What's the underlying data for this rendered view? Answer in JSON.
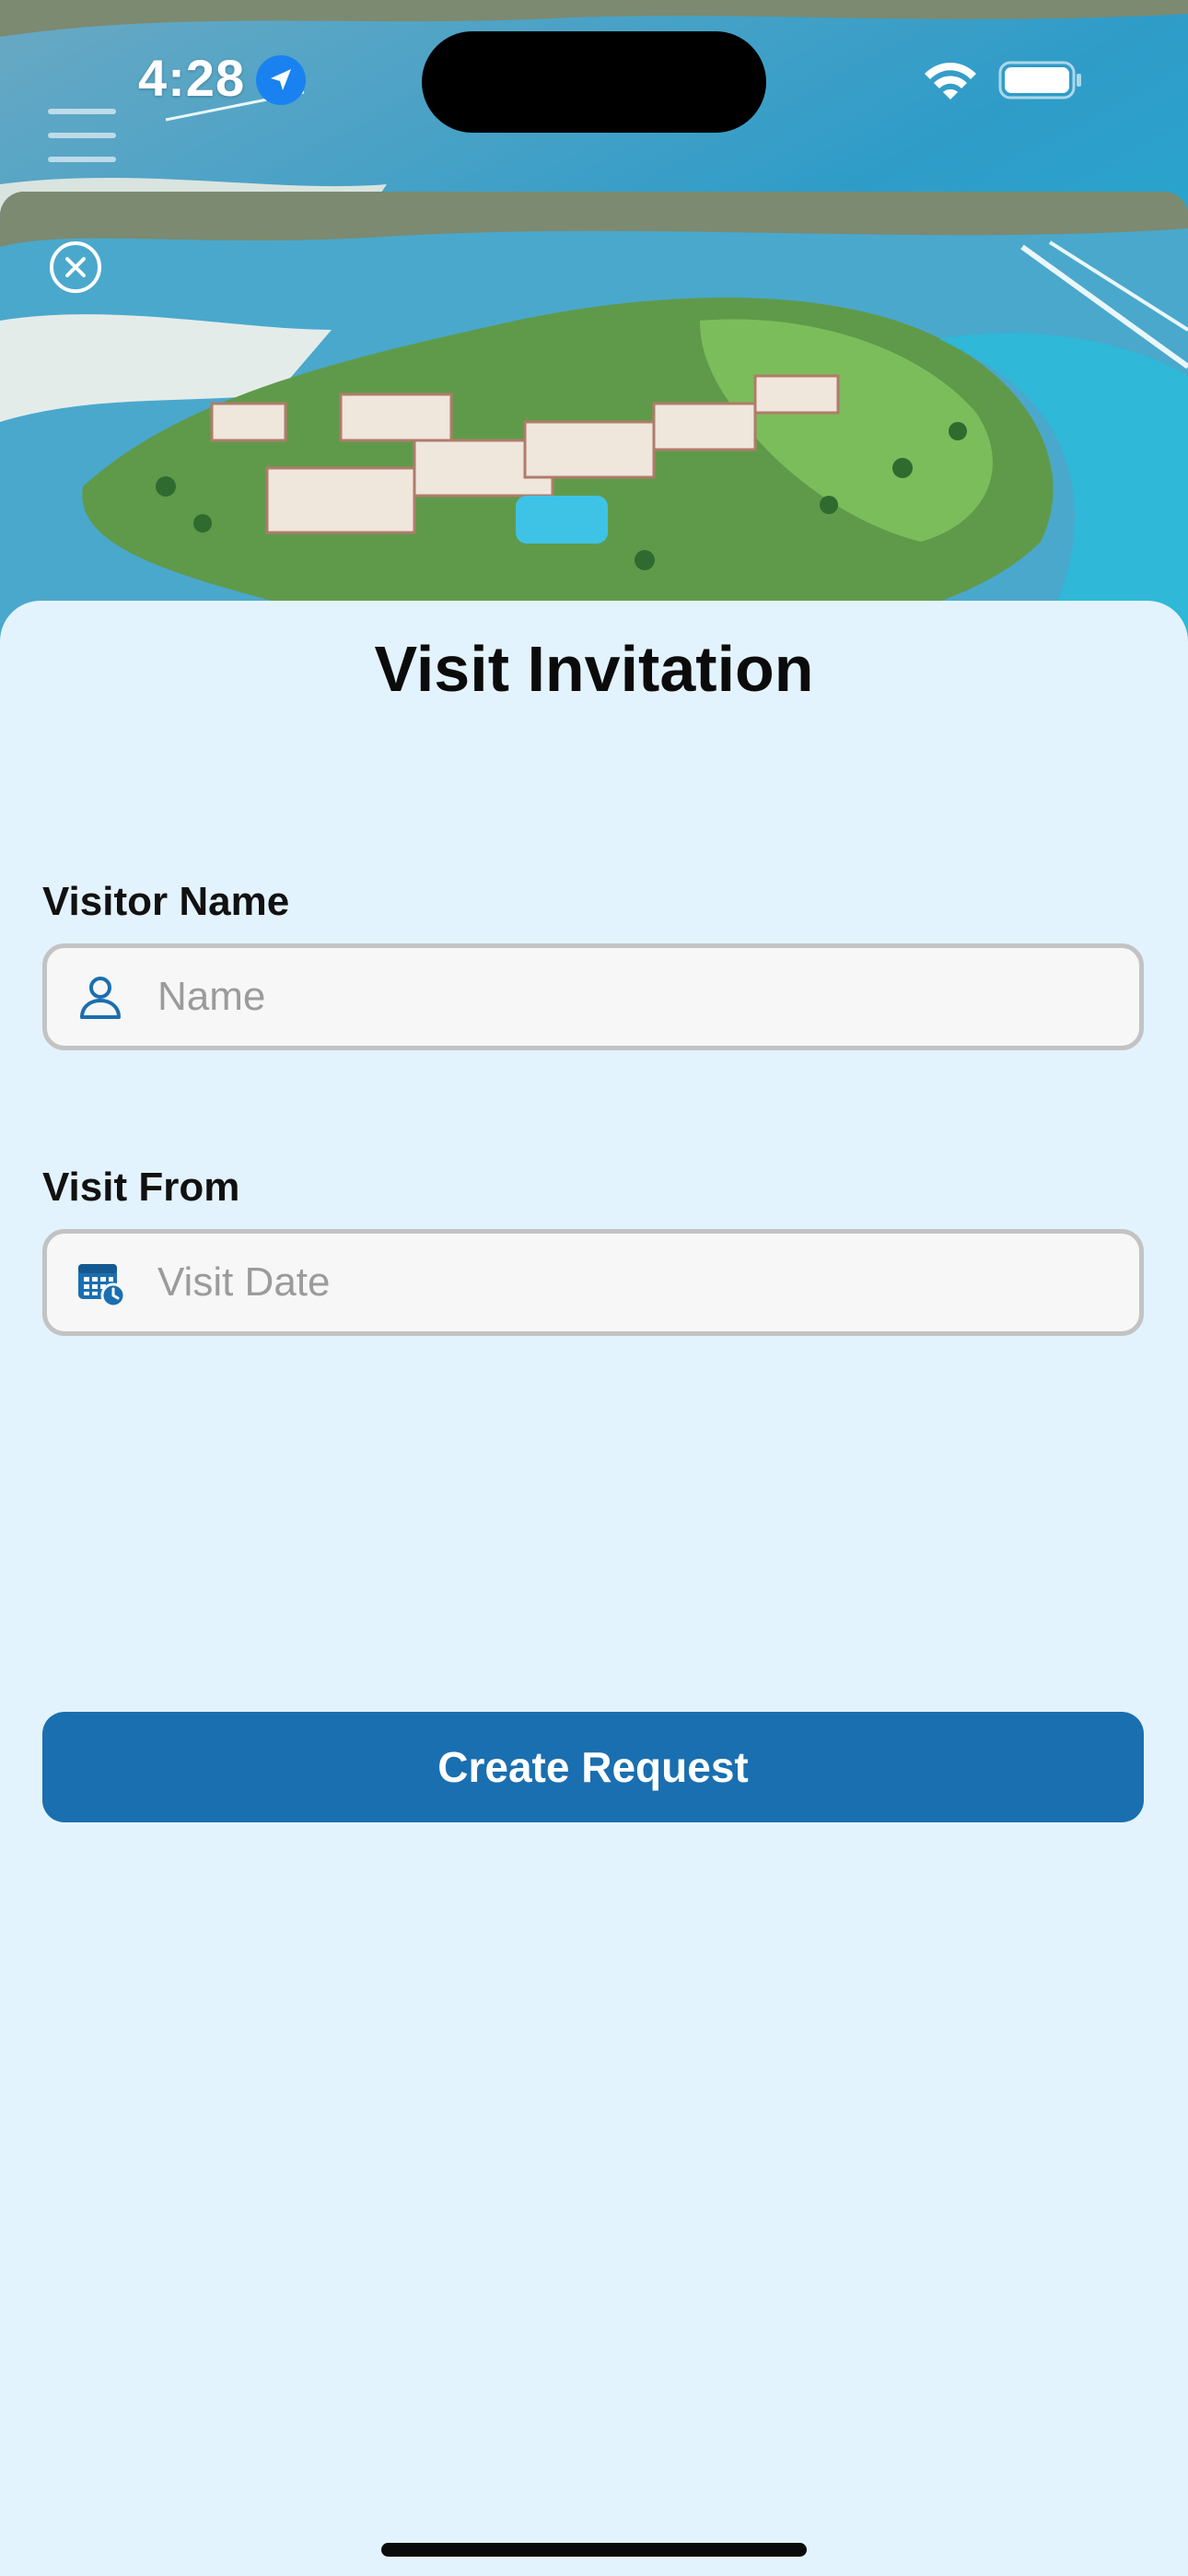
{
  "status_bar": {
    "time": "4:28"
  },
  "sheet": {
    "title": "Visit Invitation"
  },
  "form": {
    "visitor_name": {
      "label": "Visitor Name",
      "placeholder": "Name",
      "value": ""
    },
    "visit_from": {
      "label": "Visit From",
      "placeholder": "Visit Date",
      "value": ""
    },
    "submit_label": "Create Request"
  },
  "icons": {
    "menu": "hamburger-menu-icon",
    "close": "close-circle-icon",
    "person": "person-icon",
    "calendar": "calendar-clock-icon",
    "location": "location-arrow-icon",
    "wifi": "wifi-icon",
    "battery": "battery-icon"
  },
  "colors": {
    "background": "#e3f3fd",
    "accent": "#1a6fb0",
    "field_fill": "#f7f7f7",
    "field_border": "#c3c3c3",
    "location_badge": "#1a82f0"
  }
}
